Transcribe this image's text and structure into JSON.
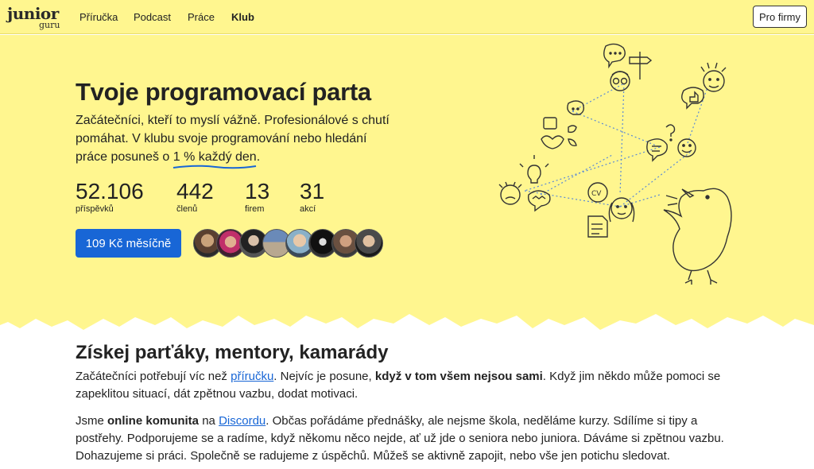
{
  "nav": {
    "logo_main": "junior",
    "logo_sub": "guru",
    "items": [
      "Příručka",
      "Podcast",
      "Práce",
      "Klub"
    ],
    "for_companies": "Pro firmy"
  },
  "hero": {
    "title": "Tvoje programovací parta",
    "lead_1": "Začátečníci, kteří to myslí vážně. Profesionálové s chutí pomáhat. V klubu svoje programování nebo hledání práce posuneš o ",
    "lead_highlight": "1 % každý den",
    "lead_2": ".",
    "stats": [
      {
        "value": "52.106",
        "label": "příspěvků"
      },
      {
        "value": "442",
        "label": "členů"
      },
      {
        "value": "13",
        "label": "firem"
      },
      {
        "value": "31",
        "label": "akcí"
      }
    ],
    "cta": "109 Kč měsíčně",
    "accent_color": "#1866d6",
    "bg_color": "#fff68f"
  },
  "section": {
    "heading": "Získej parťáky, mentory, kamarády",
    "p1_a": "Začátečníci potřebují víc než ",
    "p1_link": "příručku",
    "p1_b": ". Nejvíc je posune, ",
    "p1_bold": "když v tom všem nejsou sami",
    "p1_c": ". Když jim někdo může pomoci se zapeklitou situací, dát zpětnou vazbu, dodat motivaci.",
    "p2_a": "Jsme ",
    "p2_bold": "online komunita",
    "p2_b": " na ",
    "p2_link": "Discordu",
    "p2_c": ". Občas pořádáme přednášky, ale nejsme škola, neděláme kurzy. Sdílíme si tipy a postřehy. Podporujeme se a radíme, když někomu něco nejde, ať už jde o seniora nebo juniora. Dáváme si zpětnou vazbu. Dohazujeme si práci. Společně se radujeme z úspěchů. Můžeš se aktivně zapojit, nebo vše jen potichu sledovat."
  }
}
